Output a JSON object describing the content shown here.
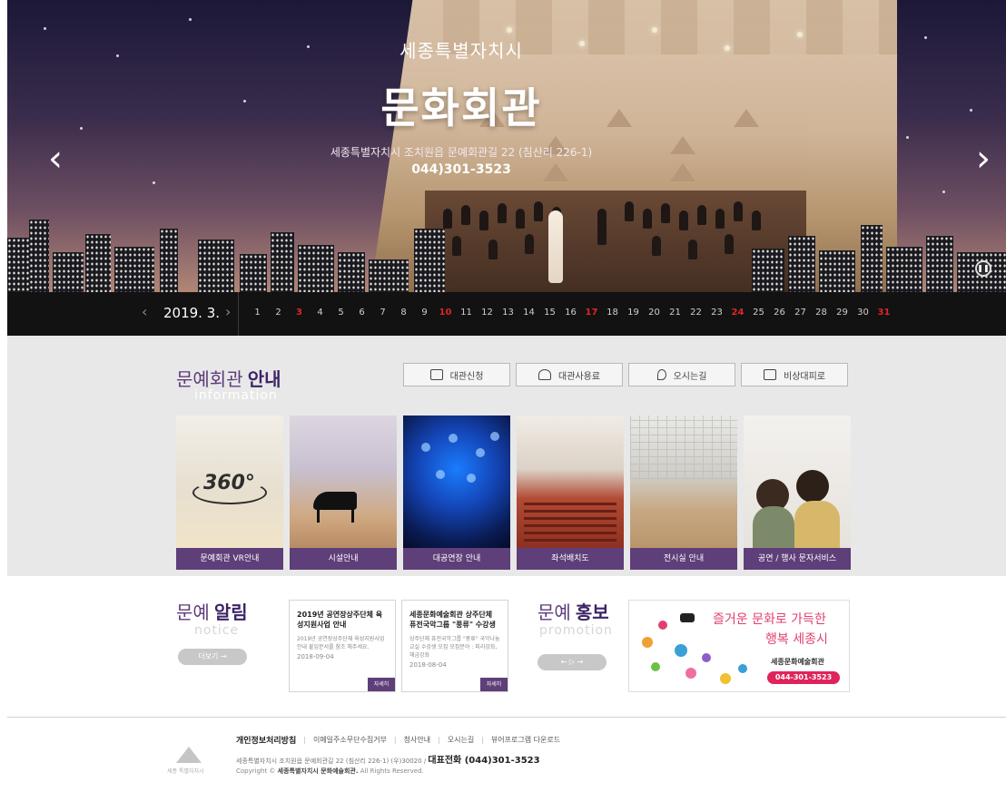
{
  "hero": {
    "subtitle": "세종특별자치시",
    "title": "문화회관",
    "address": "세종특별자치시 조치원읍 문예회관길 22 (침산리 226-1)",
    "phone": "044)301-3523",
    "prev_icon": "chevron-left-icon",
    "next_icon": "chevron-right-icon",
    "pause_icon": "pause-icon"
  },
  "calendar": {
    "month": "2019. 3.",
    "days": [
      "1",
      "2",
      "3",
      "4",
      "5",
      "6",
      "7",
      "8",
      "9",
      "10",
      "11",
      "12",
      "13",
      "14",
      "15",
      "16",
      "17",
      "18",
      "19",
      "20",
      "21",
      "22",
      "23",
      "24",
      "25",
      "26",
      "27",
      "28",
      "29",
      "30",
      "31"
    ],
    "red_days": [
      "3",
      "10",
      "17",
      "24",
      "31"
    ],
    "red_color": "#e02424"
  },
  "info": {
    "title_light": "문예회관",
    "title_bold": "안내",
    "title_en": "information",
    "buttons": [
      {
        "label": "대관신청",
        "icon": "calendar-icon"
      },
      {
        "label": "대관사용료",
        "icon": "money-icon"
      },
      {
        "label": "오시는길",
        "icon": "location-icon"
      },
      {
        "label": "비상대피로",
        "icon": "emergency-exit-icon"
      }
    ],
    "tiles": [
      {
        "label": "문예회관 VR안내",
        "overlay": "360°"
      },
      {
        "label": "시설안내"
      },
      {
        "label": "대공연장 안내"
      },
      {
        "label": "좌석배치도"
      },
      {
        "label": "전시실 안내"
      },
      {
        "label": "공연 / 행사 문자서비스"
      }
    ]
  },
  "notice": {
    "title_light": "문예",
    "title_bold": "알림",
    "title_en": "notice",
    "more_label": "더보기 →",
    "cards": [
      {
        "title": "2019년 공연장상주단체 육성지원사업 안내",
        "body": "2019년 공연장상주단체 육성지원사업 안내 붙임문서를 참조 해주세요.",
        "date": "2018-09-04",
        "button": "자세히"
      },
      {
        "title": "세종문화예술회관 상주단체 퓨전국악그룹 \"풍류\" 수강생",
        "body": "상주단체 퓨전국악그룹 \"풍류\" 국악나눔교실 수강생 모집 모집분야 : 피리강좌, 해금강좌",
        "date": "2018-08-04",
        "button": "자세히"
      }
    ]
  },
  "promotion": {
    "title_light": "문예",
    "title_bold": "홍보",
    "title_en": "promotion",
    "controls": "←  ▷  →",
    "banner": {
      "line1": "즐거운 문화로 가득한",
      "line2": "행복 세종시",
      "org": "세종문화예술회관",
      "tel": "044-301-3523"
    }
  },
  "footer": {
    "links": [
      "개인정보처리방침",
      "이메일주소무단수집거부",
      "청사안내",
      "오시는길",
      "뷰어프로그램 다운로드"
    ],
    "address": "세종특별자치시 조치원읍 문예회관길 22 (침산리 226-1) (우)30020 /",
    "phone_label": "대표전화 (044)301-3523",
    "copy_prefix": "Copyright ©",
    "copy_org": "세종특별자치시 문화예술회관.",
    "copy_suffix": "All Rights Reserved.",
    "logo_text": "세종 특별자치시"
  },
  "colors": {
    "accent": "#5e3f79",
    "title_dark": "#3c2366",
    "banner_pink": "#e0235b",
    "calendar_bg": "#121212"
  }
}
